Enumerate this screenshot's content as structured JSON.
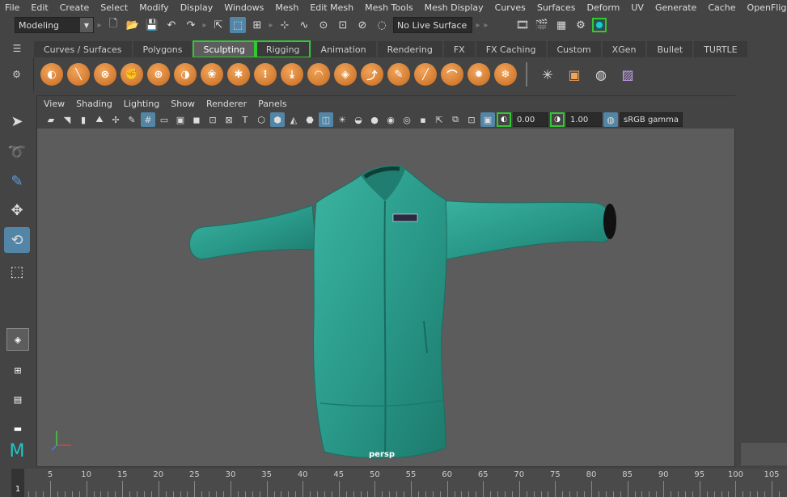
{
  "menubar": [
    "File",
    "Edit",
    "Create",
    "Select",
    "Modify",
    "Display",
    "Windows",
    "Mesh",
    "Edit Mesh",
    "Mesh Tools",
    "Mesh Display",
    "Curves",
    "Surfaces",
    "Deform",
    "UV",
    "Generate",
    "Cache",
    "OpenFlight"
  ],
  "status": {
    "mode": "Modeling",
    "live_surface": "No Live Surface"
  },
  "shelf": {
    "tabs": [
      "Curves / Surfaces",
      "Polygons",
      "Sculpting",
      "Rigging",
      "Animation",
      "Rendering",
      "FX",
      "FX Caching",
      "Custom",
      "XGen",
      "Bullet",
      "TURTLE"
    ],
    "active_tab": "Sculpting"
  },
  "panel": {
    "menus": [
      "View",
      "Shading",
      "Lighting",
      "Show",
      "Renderer",
      "Panels"
    ],
    "exposure": "0.00",
    "gamma": "1.00",
    "color_space": "sRGB gamma",
    "camera": "persp"
  },
  "timeslider": {
    "current_frame": "1",
    "labels": [
      "5",
      "10",
      "15",
      "20",
      "25",
      "30",
      "35",
      "40",
      "45",
      "50",
      "55",
      "60",
      "65",
      "70",
      "75",
      "80",
      "85",
      "90",
      "95",
      "100",
      "105"
    ]
  },
  "colors": {
    "accent": "#5285a6",
    "highlight": "#32c832",
    "jacket": "#2a9a8a",
    "viewport_bg": "#5c5c5c"
  }
}
